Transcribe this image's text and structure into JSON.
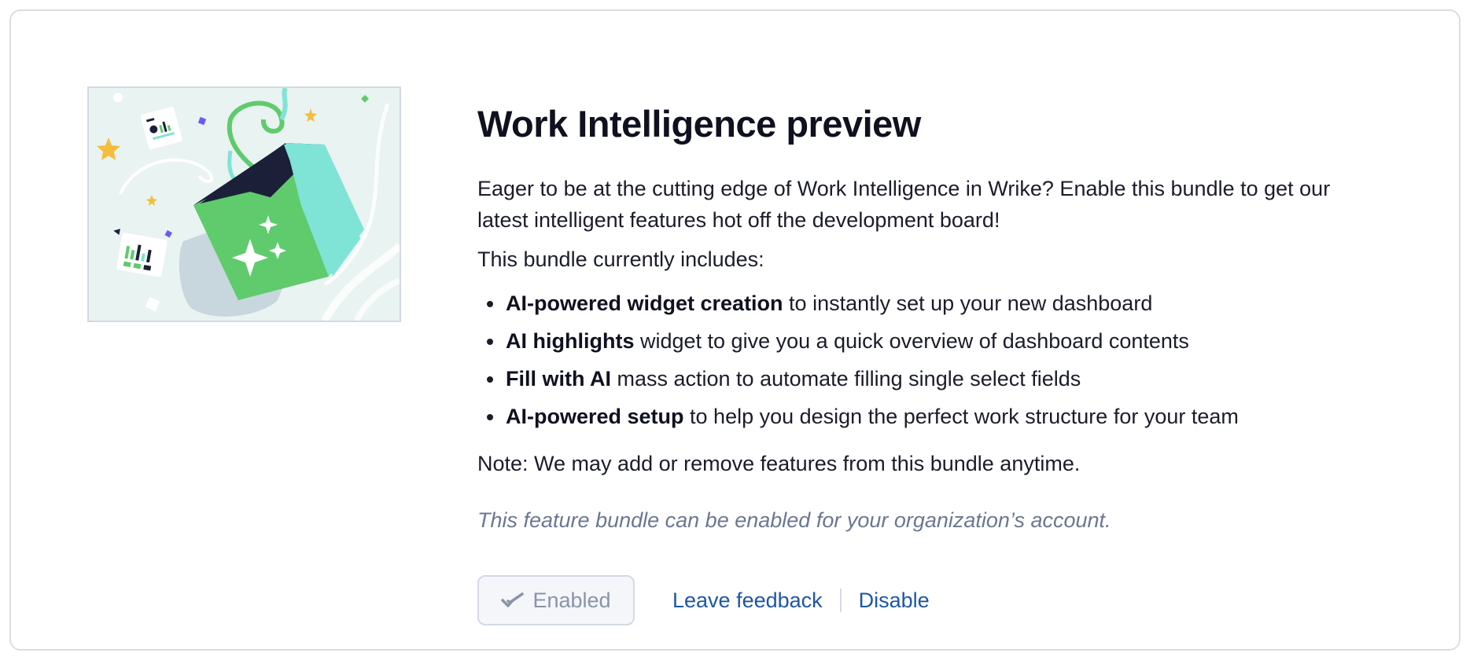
{
  "card": {
    "title": "Work Intelligence preview",
    "description": "Eager to be at the cutting edge of Work Intelligence in Wrike? Enable this bundle to get our latest intelligent features hot off the development board!",
    "includes_label": "This bundle currently includes:",
    "features": [
      {
        "name": "AI-powered widget creation",
        "rest": " to instantly set up your new dashboard"
      },
      {
        "name": "AI highlights",
        "rest": " widget to give you a quick overview of dashboard contents"
      },
      {
        "name": "Fill with AI",
        "rest": " mass action to automate filling single select fields"
      },
      {
        "name": "AI-powered setup",
        "rest": " to help you design the perfect work structure for your team"
      }
    ],
    "note": "Note: We may add or remove features from this bundle anytime.",
    "account_note": "This feature bundle can be enabled for your organization’s account.",
    "actions": {
      "enabled_label": "Enabled",
      "enabled_icon": "double-check-icon",
      "feedback_label": "Leave feedback",
      "disable_label": "Disable"
    }
  },
  "colors": {
    "title": "#0f1120",
    "link": "#1e56a6",
    "muted_italic": "#6b7791",
    "card_border": "#dadde3",
    "box_green": "#5fcb6d",
    "box_teal": "#7fe3d6",
    "box_dark": "#1b2038",
    "star_yellow": "#f4be3a"
  }
}
